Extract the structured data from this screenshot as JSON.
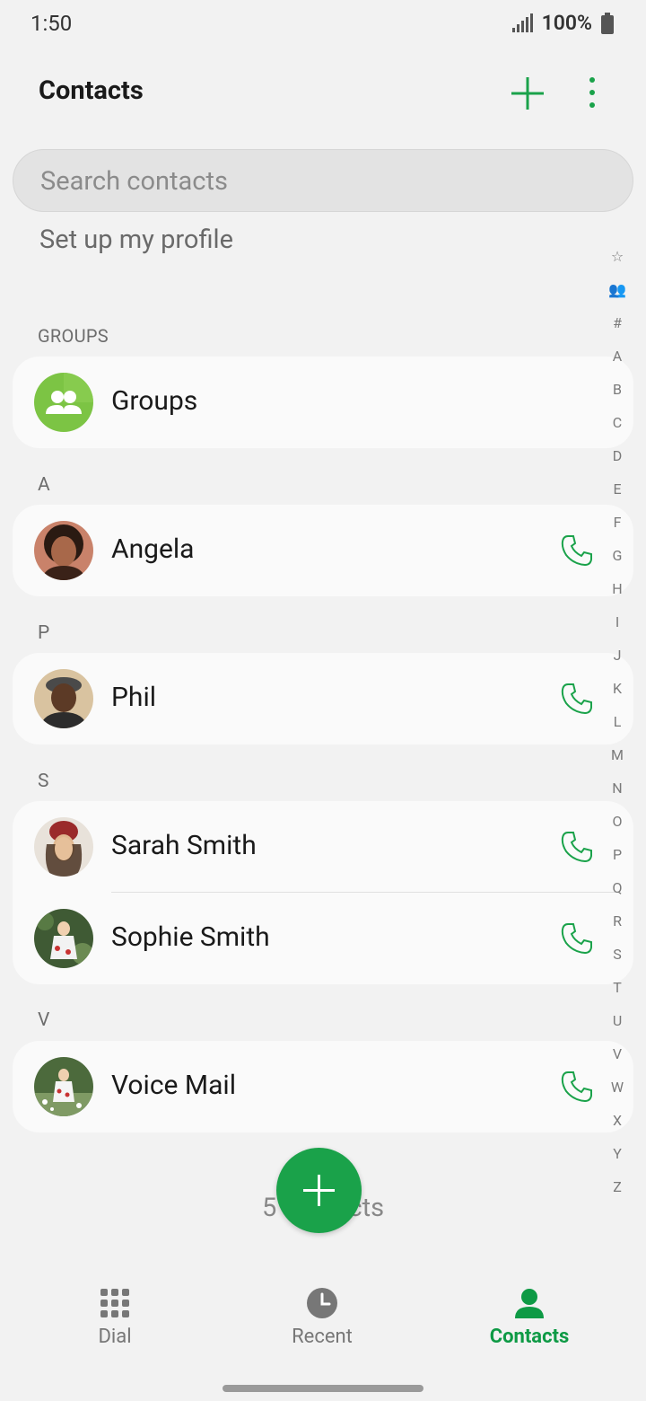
{
  "status": {
    "time": "1:50",
    "battery": "100%"
  },
  "header": {
    "title": "Contacts"
  },
  "search": {
    "placeholder": "Search contacts"
  },
  "profile": {
    "setup_label": "Set up my profile"
  },
  "groups_section": {
    "label": "GROUPS",
    "item_label": "Groups"
  },
  "sections": [
    {
      "letter": "A",
      "contacts": [
        {
          "name": "Angela"
        }
      ]
    },
    {
      "letter": "P",
      "contacts": [
        {
          "name": "Phil"
        }
      ]
    },
    {
      "letter": "S",
      "contacts": [
        {
          "name": "Sarah Smith"
        },
        {
          "name": "Sophie Smith"
        }
      ]
    },
    {
      "letter": "V",
      "contacts": [
        {
          "name": "Voice Mail"
        }
      ]
    }
  ],
  "alpha_index": [
    "☆",
    "👥",
    "#",
    "A",
    "B",
    "C",
    "D",
    "E",
    "F",
    "G",
    "H",
    "I",
    "J",
    "K",
    "L",
    "M",
    "N",
    "O",
    "P",
    "Q",
    "R",
    "S",
    "T",
    "U",
    "V",
    "W",
    "X",
    "Y",
    "Z"
  ],
  "footer": {
    "count": "5 contacts"
  },
  "nav": {
    "dial": "Dial",
    "recent": "Recent",
    "contacts": "Contacts"
  },
  "colors": {
    "accent": "#1aa24a",
    "active_nav": "#0e9a45"
  }
}
